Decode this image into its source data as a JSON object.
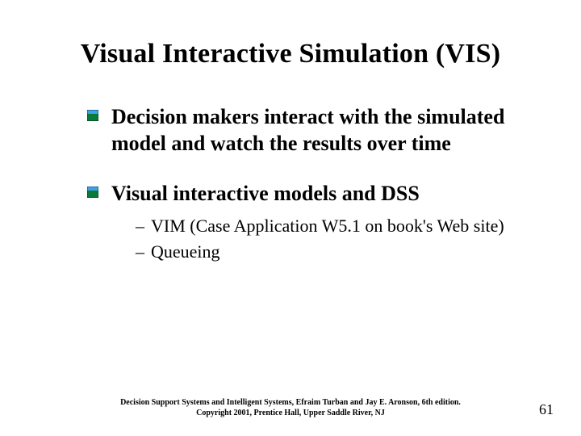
{
  "title": "Visual Interactive Simulation (VIS)",
  "bullets": [
    {
      "text": "Decision makers interact with the simulated model and watch the results over time",
      "subs": []
    },
    {
      "text": "Visual interactive models and DSS",
      "subs": [
        "VIM (Case Application W5.1 on book's Web site)",
        "Queueing"
      ]
    }
  ],
  "footer_line1": "Decision Support Systems and Intelligent Systems, Efraim Turban and Jay E. Aronson, 6th edition.",
  "footer_line2": "Copyright 2001, Prentice Hall, Upper Saddle River, NJ",
  "page_number": "61",
  "icon_name": "square-bullet-icon"
}
